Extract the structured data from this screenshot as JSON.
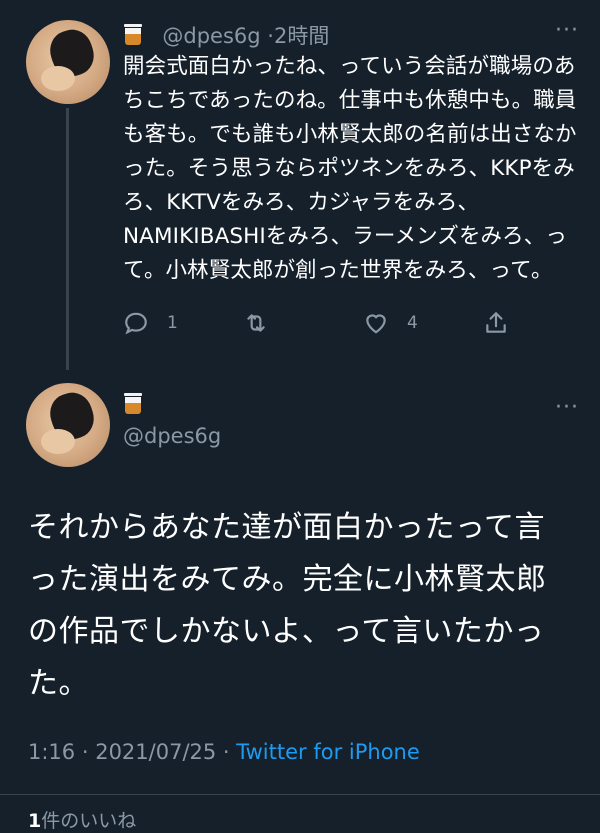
{
  "tweet1": {
    "handle": "@dpes6g",
    "time": "2時間",
    "text": "開会式面白かったね、っていう会話が職場のあちこちであったのね。仕事中も休憩中も。職員も客も。でも誰も小林賢太郎の名前は出さなかった。そう思うならポツネンをみろ、KKPをみろ、KKTVをみろ、カジャラをみろ、NAMIKIBASHIをみろ、ラーメンズをみろ、って。小林賢太郎が創った世界をみろ、って。",
    "reply_count": "1",
    "like_count": "4"
  },
  "tweet2": {
    "handle": "@dpes6g",
    "text": "それからあなた達が面白かったって言った演出をみてみ。完全に小林賢太郎の作品でしかないよ、って言いたかった。",
    "time": "1:16",
    "date": "2021/07/25",
    "source": "Twitter for iPhone",
    "likes_count": "1",
    "likes_label": "件のいいね"
  },
  "icons": [
    "whisky-glass-emoji",
    "more-icon",
    "reply-icon",
    "retweet-icon",
    "like-icon",
    "share-icon"
  ],
  "colors": {
    "background": "#15202b",
    "text": "#ffffff",
    "secondary": "#8b98a5",
    "link": "#1d9bf0"
  }
}
